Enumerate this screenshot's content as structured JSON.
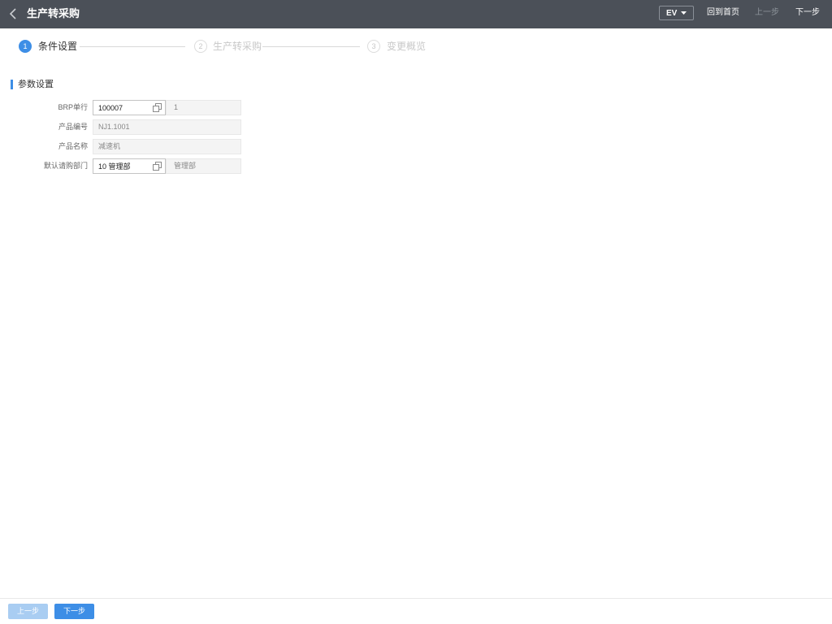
{
  "header": {
    "back_icon": "chevron-left-icon",
    "title": "生产转采购",
    "lang_select": {
      "value": "EV",
      "icon": "caret-down-icon"
    },
    "home_label": "回到首页",
    "prev_label": "上一步",
    "prev_enabled": false,
    "next_label": "下一步"
  },
  "steps": {
    "current_step": 1,
    "items": [
      {
        "number": "1",
        "label": "条件设置"
      },
      {
        "number": "2",
        "label": "生产转采购"
      },
      {
        "number": "3",
        "label": "变更概览"
      }
    ]
  },
  "section": {
    "title": "参数设置"
  },
  "form": {
    "lookup_icon": "copy-icon",
    "rows": [
      {
        "label": "BRP单行",
        "input_value": "100007",
        "display_value": "1"
      },
      {
        "label": "产品编号",
        "display_value": "NJ1.1001"
      },
      {
        "label": "产品名称",
        "display_value": "减速机"
      },
      {
        "label": "默认请购部门",
        "input_value": "10 管理部",
        "display_value": "管理部"
      }
    ]
  },
  "footer": {
    "prev_label": "上一步",
    "prev_enabled": false,
    "next_label": "下一步"
  },
  "colors": {
    "header_bg": "#4b5058",
    "accent": "#3d8ee6",
    "accent_disabled": "#a9cdf2",
    "muted_text": "#c8c8c8"
  }
}
